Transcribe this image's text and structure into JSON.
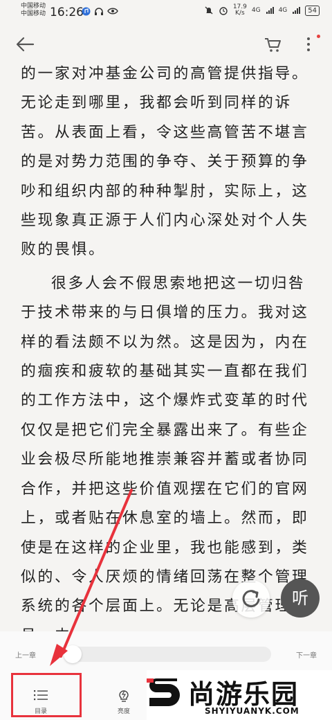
{
  "status_bar": {
    "carrier1": "中国移动",
    "carrier2": "中国移动",
    "time": "16:26",
    "speed_value": "17.9",
    "speed_unit": "K/s",
    "signal1": "4G",
    "signal2": "4G",
    "battery": "54"
  },
  "content": {
    "paragraph1": "的一家对冲基金公司的高管提供指导。无论走到哪里，我都会听到同样的诉苦。从表面上看，令这些高管苦不堪言的是对势力范围的争夺、关于预算的争吵和组织内部的种种掣肘，实际上，这些现象真正源于人们内心深处对个人失败的畏惧。",
    "paragraph2": "很多人会不假思索地把这一切归咎于技术带来的与日俱增的压力。我对这样的看法颇不以为然。这是因为，内在的痼疾和疲软的基础其实一直都在我们的工作方法中，这个爆炸式变革的时代仅仅是把它们完全暴露出来了。有些企业会极尽所能地推崇兼容并蓄或者协同合作，并把这些价值观摆在它们的官网上，或者贴在休息室的墙上。然而，即使是在这样的企业里，我也能感到，类似的、令人厌烦的情绪回荡在整个管理系统的各个层面上。无论是高层管理人员，中"
  },
  "floating": {
    "listen_label": "听"
  },
  "reader_controls": {
    "prev_chapter": "上一章",
    "next_chapter": "下一章",
    "progress": 0.0,
    "catalog_label": "目录",
    "brightness_label": "亮度"
  },
  "watermark": {
    "brand": "尚游乐园",
    "url": "SHYIYUANYK.COM"
  },
  "colors": {
    "accent_red": "#e8323c",
    "page_bg": "#f5f4f2"
  }
}
